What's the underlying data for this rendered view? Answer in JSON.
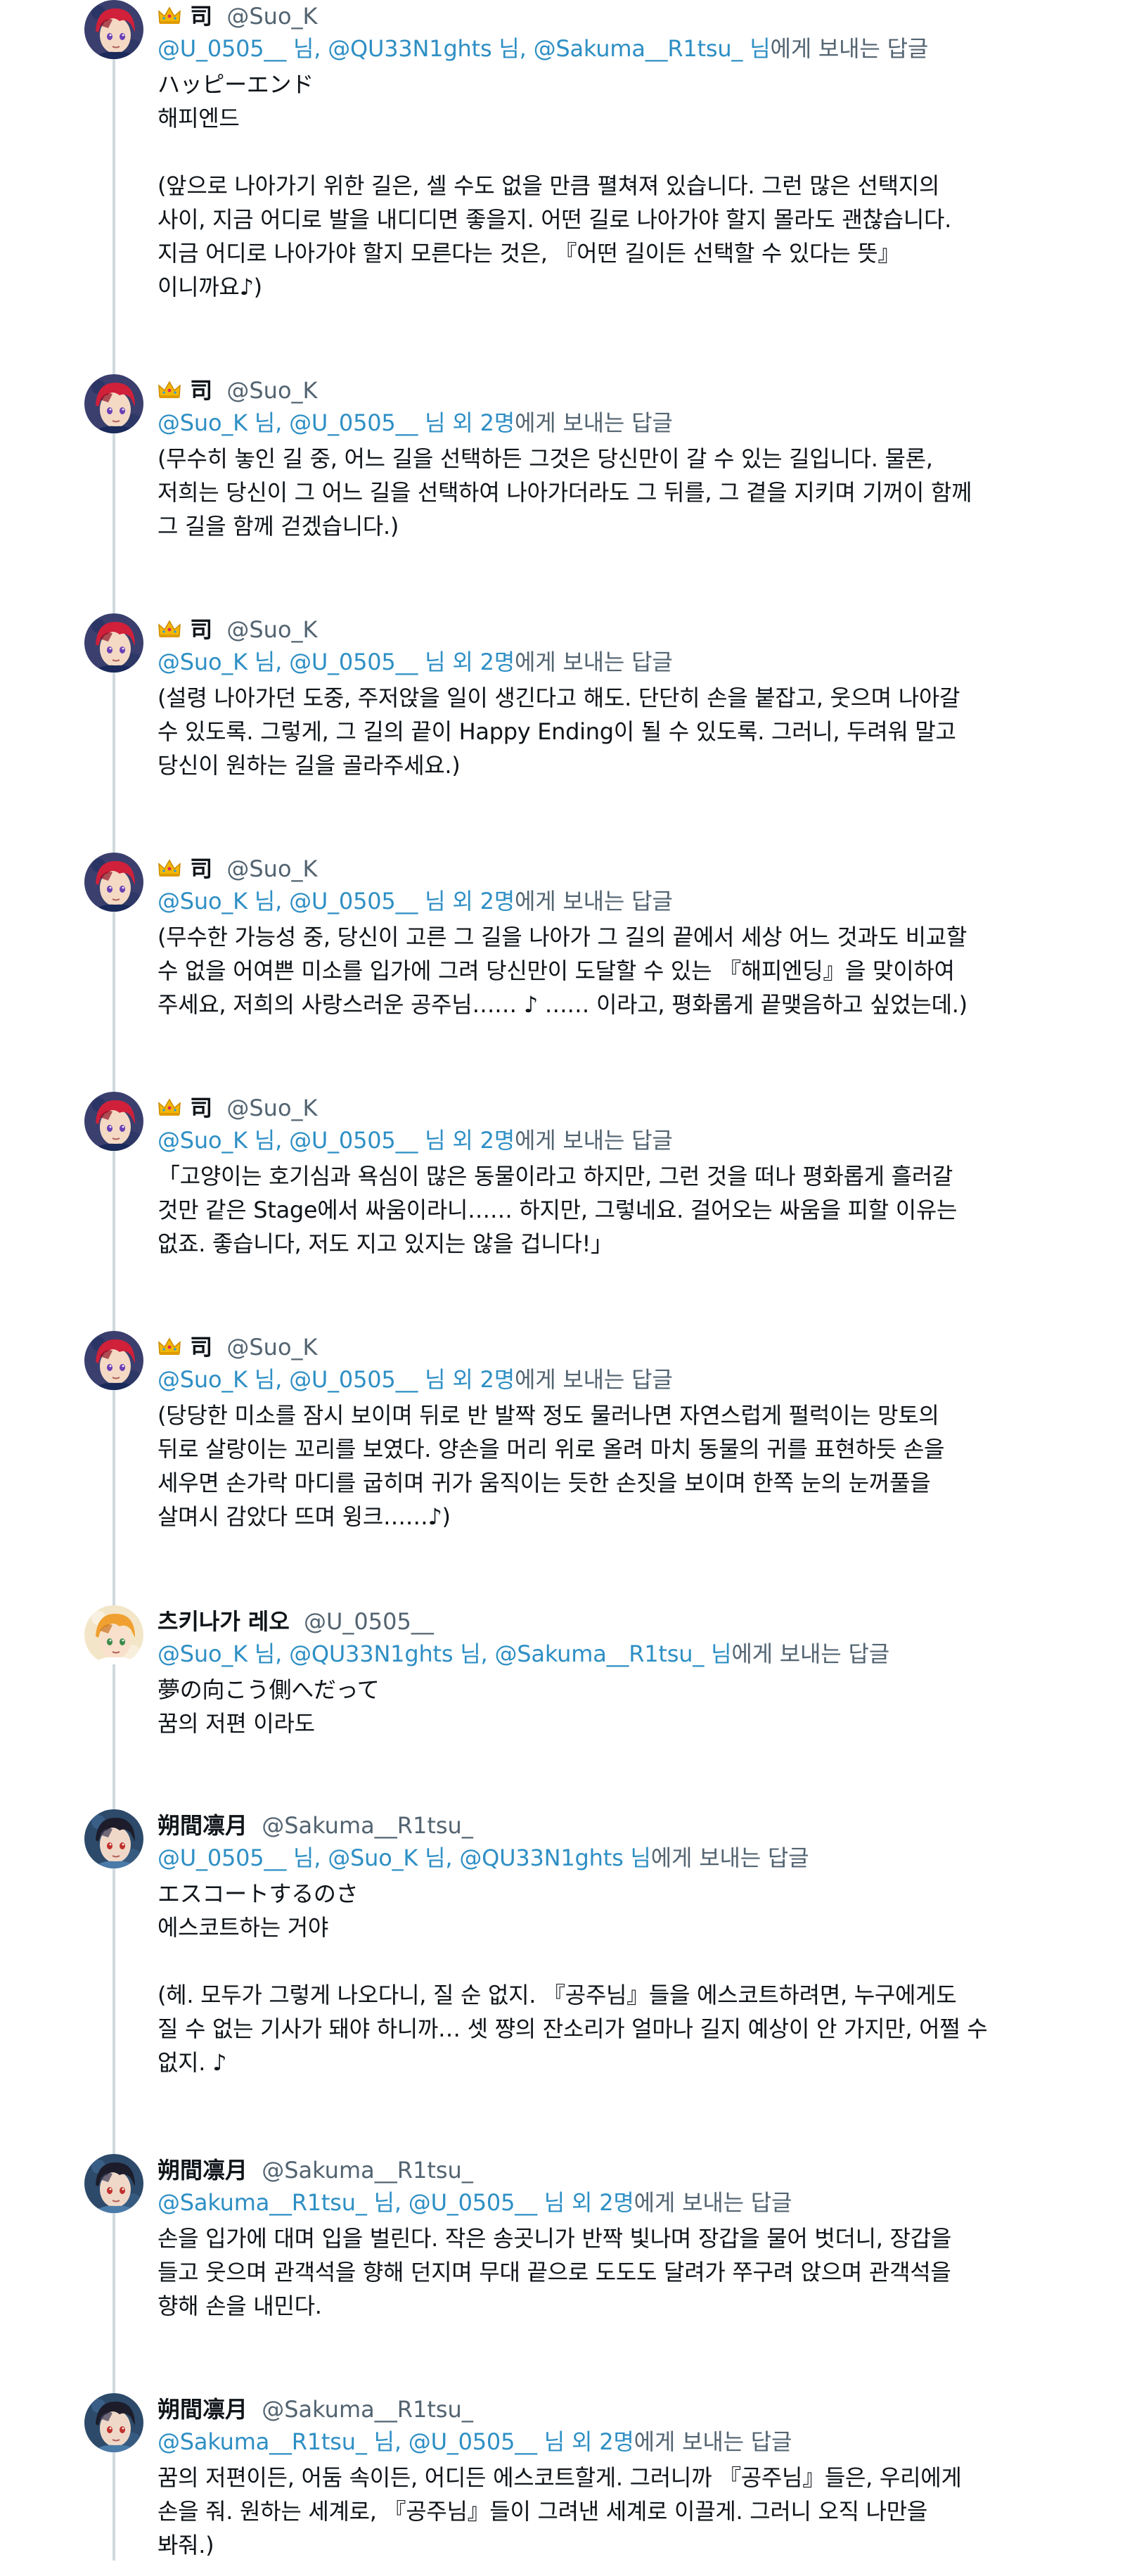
{
  "thread": {
    "tweets": [
      {
        "author": {
          "display_name": "司",
          "handle": "@Suo_K",
          "crown": true,
          "avatar": "red-hair-avatar"
        },
        "reply_to": {
          "mentions": "@U_0505__ 님, @QU33N1ghts 님, @Sakuma__R1tsu_ 님",
          "suffix": "에게 보내는 답글"
        },
        "lines": [
          "ハッピーエンド",
          "해피엔드",
          "",
          "(앞으로 나아가기 위한 길은, 셀 수도 없을 만큼 펼쳐져 있습니다. 그런 많은 선택지의",
          "사이, 지금 어디로 발을 내디디면 좋을지. 어떤 길로 나아가야 할지 몰라도 괜찮습니다.",
          "지금 어디로 나아가야 할지 모른다는 것은, 『어떤 길이든 선택할 수 있다는 뜻』",
          "이니까요♪)"
        ]
      },
      {
        "author": {
          "display_name": "司",
          "handle": "@Suo_K",
          "crown": true,
          "avatar": "red-hair-avatar"
        },
        "reply_to": {
          "mentions": "@Suo_K 님, @U_0505__ 님 외 2명",
          "suffix": "에게 보내는 답글"
        },
        "lines": [
          "(무수히 놓인 길 중, 어느 길을 선택하든 그것은 당신만이 갈 수 있는 길입니다. 물론,",
          "저희는 당신이 그 어느 길을 선택하여 나아가더라도 그 뒤를, 그 곁을 지키며 기꺼이 함께",
          "그 길을 함께 걷겠습니다.)"
        ]
      },
      {
        "author": {
          "display_name": "司",
          "handle": "@Suo_K",
          "crown": true,
          "avatar": "red-hair-avatar"
        },
        "reply_to": {
          "mentions": "@Suo_K 님, @U_0505__ 님 외 2명",
          "suffix": "에게 보내는 답글"
        },
        "lines": [
          "(설령 나아가던 도중, 주저앉을 일이 생긴다고 해도. 단단히 손을 붙잡고, 웃으며 나아갈",
          "수 있도록. 그렇게, 그 길의 끝이 Happy Ending이 될 수 있도록. 그러니, 두려워 말고",
          "당신이 원하는 길을 골라주세요.)"
        ]
      },
      {
        "author": {
          "display_name": "司",
          "handle": "@Suo_K",
          "crown": true,
          "avatar": "red-hair-avatar"
        },
        "reply_to": {
          "mentions": "@Suo_K 님, @U_0505__ 님 외 2명",
          "suffix": "에게 보내는 답글"
        },
        "lines": [
          "(무수한 가능성 중, 당신이 고른 그 길을 나아가 그 길의 끝에서 세상 어느 것과도 비교할",
          "수 없을 어여쁜 미소를 입가에 그려 당신만이 도달할 수 있는 『해피엔딩』을 맞이하여",
          "주세요, 저희의 사랑스러운 공주님…… ♪ …… 이라고, 평화롭게 끝맺음하고 싶었는데.)"
        ]
      },
      {
        "author": {
          "display_name": "司",
          "handle": "@Suo_K",
          "crown": true,
          "avatar": "red-hair-avatar"
        },
        "reply_to": {
          "mentions": "@Suo_K 님, @U_0505__ 님 외 2명",
          "suffix": "에게 보내는 답글"
        },
        "lines": [
          "「고양이는 호기심과 욕심이 많은 동물이라고 하지만, 그런 것을 떠나 평화롭게 흘러갈",
          "것만 같은 Stage에서 싸움이라니…… 하지만, 그렇네요. 걸어오는 싸움을 피할 이유는",
          "없죠. 좋습니다, 저도 지고 있지는 않을 겁니다!」"
        ]
      },
      {
        "author": {
          "display_name": "司",
          "handle": "@Suo_K",
          "crown": true,
          "avatar": "red-hair-avatar"
        },
        "reply_to": {
          "mentions": "@Suo_K 님, @U_0505__ 님 외 2명",
          "suffix": "에게 보내는 답글"
        },
        "lines": [
          "(당당한 미소를 잠시 보이며 뒤로 반 발짝 정도 물러나면 자연스럽게 펄럭이는 망토의",
          "뒤로 살랑이는 꼬리를 보였다. 양손을 머리 위로 올려 마치 동물의 귀를 표현하듯 손을",
          "세우면 손가락 마디를 굽히며 귀가 움직이는 듯한 손짓을 보이며 한쪽 눈의 눈꺼풀을",
          "살며시 감았다 뜨며 윙크……♪)"
        ]
      },
      {
        "author": {
          "display_name": "츠키나가 레오",
          "handle": "@U_0505__",
          "crown": false,
          "avatar": "orange-hair-avatar"
        },
        "reply_to": {
          "mentions": "@Suo_K 님, @QU33N1ghts 님, @Sakuma__R1tsu_ 님",
          "suffix": "에게 보내는 답글"
        },
        "lines": [
          "夢の向こう側へだって",
          "꿈의 저편 이라도"
        ]
      },
      {
        "author": {
          "display_name": "朔間凛月",
          "handle": "@Sakuma__R1tsu_",
          "crown": false,
          "avatar": "dark-hair-avatar"
        },
        "reply_to": {
          "mentions": "@U_0505__ 님, @Suo_K 님, @QU33N1ghts 님",
          "suffix": "에게 보내는 답글"
        },
        "lines": [
          "エスコートするのさ",
          "에스코트하는 거야",
          "",
          "(헤. 모두가 그렇게 나오다니, 질 순 없지. 『공주님』들을 에스코트하려면, 누구에게도",
          "질 수 없는 기사가 돼야 하니까… 셋 쨩의 잔소리가 얼마나 길지 예상이 안 가지만, 어쩔 수",
          "없지. ♪"
        ]
      },
      {
        "author": {
          "display_name": "朔間凛月",
          "handle": "@Sakuma__R1tsu_",
          "crown": false,
          "avatar": "dark-hair-avatar"
        },
        "reply_to": {
          "mentions": "@Sakuma__R1tsu_ 님, @U_0505__ 님 외 2명",
          "suffix": "에게 보내는 답글"
        },
        "lines": [
          "손을 입가에 대며 입을 벌린다. 작은 송곳니가 반짝 빛나며 장갑을 물어 벗더니, 장갑을",
          "들고 웃으며 관객석을 향해 던지며 무대 끝으로 도도도 달려가 쭈구려 앉으며 관객석을",
          "향해 손을 내민다."
        ]
      },
      {
        "author": {
          "display_name": "朔間凛月",
          "handle": "@Sakuma__R1tsu_",
          "crown": false,
          "avatar": "dark-hair-avatar"
        },
        "reply_to": {
          "mentions": "@Sakuma__R1tsu_ 님, @U_0505__ 님 외 2명",
          "suffix": "에게 보내는 답글"
        },
        "lines": [
          "꿈의 저편이든, 어둠 속이든, 어디든 에스코트할게. 그러니까 『공주님』들은, 우리에게",
          "손을 줘. 원하는 세계로, 『공주님』들이 그려낸 세계로 이끌게. 그러니 오직 나만을",
          "봐줘.)"
        ]
      }
    ]
  }
}
